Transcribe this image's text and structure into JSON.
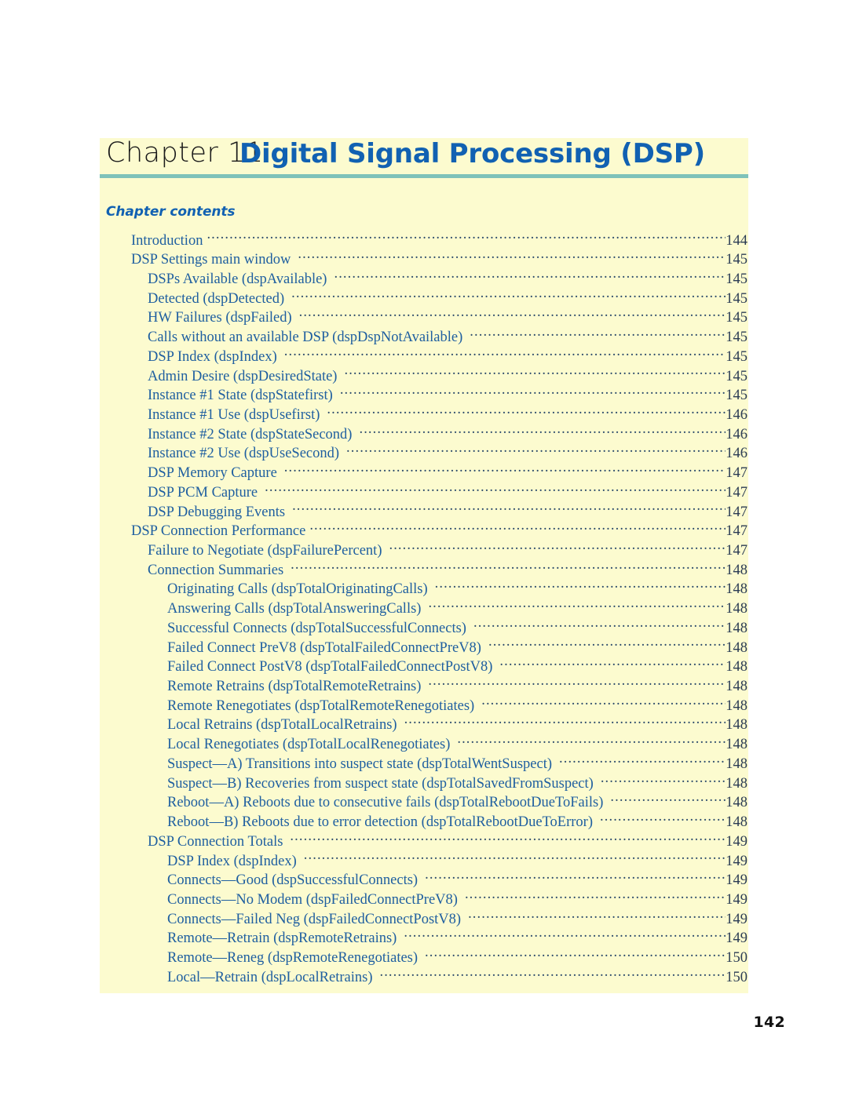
{
  "page": {
    "folio": "142",
    "accent_blue": "#1161b2",
    "toc_blue": "#1f5fa0",
    "panel_background": "#fcfbcf",
    "rule_color": "#7fc2b9"
  },
  "header": {
    "chapter_word": "Chapter 11",
    "chapter_title": "Digital Signal Processing (DSP)"
  },
  "contents": {
    "label": "Chapter contents",
    "entries": [
      {
        "level": 1,
        "label": "Introduction",
        "page": "144",
        "gap": "tight"
      },
      {
        "level": 1,
        "label": "DSP Settings main window",
        "page": "145",
        "gap": "wide"
      },
      {
        "level": 2,
        "label": "DSPs Available (dspAvailable)",
        "page": "145",
        "gap": "wide"
      },
      {
        "level": 2,
        "label": "Detected (dspDetected)",
        "page": "145",
        "gap": "wide"
      },
      {
        "level": 2,
        "label": "HW Failures (dspFailed)",
        "page": "145",
        "gap": "wide"
      },
      {
        "level": 2,
        "label": "Calls without an available DSP (dspDspNotAvailable)",
        "page": "145",
        "gap": "wide"
      },
      {
        "level": 2,
        "label": "DSP Index (dspIndex)",
        "page": "145",
        "gap": "wide"
      },
      {
        "level": 2,
        "label": "Admin Desire (dspDesiredState)",
        "page": "145",
        "gap": "wide"
      },
      {
        "level": 2,
        "label": "Instance #1 State (dspStatefirst)",
        "page": "145",
        "gap": "wide"
      },
      {
        "level": 2,
        "label": "Instance #1 Use (dspUsefirst)",
        "page": "146",
        "gap": "wide"
      },
      {
        "level": 2,
        "label": "Instance #2 State (dspStateSecond)",
        "page": "146",
        "gap": "wide"
      },
      {
        "level": 2,
        "label": "Instance #2 Use (dspUseSecond)",
        "page": "146",
        "gap": "wide"
      },
      {
        "level": 2,
        "label": "DSP Memory Capture",
        "page": "147",
        "gap": "wide"
      },
      {
        "level": 2,
        "label": "DSP PCM Capture",
        "page": "147",
        "gap": "wide"
      },
      {
        "level": 2,
        "label": "DSP Debugging Events",
        "page": "147",
        "gap": "wide"
      },
      {
        "level": 1,
        "label": "DSP Connection Performance",
        "page": "147",
        "gap": "tight"
      },
      {
        "level": 2,
        "label": "Failure to Negotiate (dspFailurePercent)",
        "page": "147",
        "gap": "wide"
      },
      {
        "level": 2,
        "label": "Connection Summaries",
        "page": "148",
        "gap": "wide"
      },
      {
        "level": 3,
        "label": "Originating Calls (dspTotalOriginatingCalls)",
        "page": "148",
        "gap": "wide"
      },
      {
        "level": 3,
        "label": "Answering Calls (dspTotalAnsweringCalls)",
        "page": "148",
        "gap": "wide"
      },
      {
        "level": 3,
        "label": "Successful Connects (dspTotalSuccessfulConnects)",
        "page": "148",
        "gap": "wide"
      },
      {
        "level": 3,
        "label": "Failed Connect PreV8 (dspTotalFailedConnectPreV8)",
        "page": "148",
        "gap": "wide"
      },
      {
        "level": 3,
        "label": "Failed Connect PostV8 (dspTotalFailedConnectPostV8)",
        "page": "148",
        "gap": "wide"
      },
      {
        "level": 3,
        "label": "Remote Retrains (dspTotalRemoteRetrains)",
        "page": "148",
        "gap": "wide"
      },
      {
        "level": 3,
        "label": "Remote Renegotiates (dspTotalRemoteRenegotiates)",
        "page": "148",
        "gap": "wide"
      },
      {
        "level": 3,
        "label": "Local Retrains (dspTotalLocalRetrains)",
        "page": "148",
        "gap": "wide"
      },
      {
        "level": 3,
        "label": "Local Renegotiates (dspTotalLocalRenegotiates)",
        "page": "148",
        "gap": "wide"
      },
      {
        "level": 3,
        "label": "Suspect—A) Transitions into suspect state (dspTotalWentSuspect)",
        "page": "148",
        "gap": "wide"
      },
      {
        "level": 3,
        "label": "Suspect—B) Recoveries from suspect state (dspTotalSavedFromSuspect)",
        "page": "148",
        "gap": "wide"
      },
      {
        "level": 3,
        "label": "Reboot—A) Reboots due to consecutive fails (dspTotalRebootDueToFails)",
        "page": "148",
        "gap": "wide"
      },
      {
        "level": 3,
        "label": "Reboot—B) Reboots due to error detection (dspTotalRebootDueToError)",
        "page": "148",
        "gap": "wide"
      },
      {
        "level": 2,
        "label": "DSP Connection Totals",
        "page": "149",
        "gap": "wide"
      },
      {
        "level": 3,
        "label": "DSP Index (dspIndex)",
        "page": "149",
        "gap": "wide"
      },
      {
        "level": 3,
        "label": "Connects—Good (dspSuccessfulConnects)",
        "page": "149",
        "gap": "wide"
      },
      {
        "level": 3,
        "label": "Connects—No Modem (dspFailedConnectPreV8)",
        "page": "149",
        "gap": "wide"
      },
      {
        "level": 3,
        "label": "Connects—Failed Neg (dspFailedConnectPostV8)",
        "page": "149",
        "gap": "wide"
      },
      {
        "level": 3,
        "label": "Remote—Retrain (dspRemoteRetrains)",
        "page": "149",
        "gap": "wide"
      },
      {
        "level": 3,
        "label": "Remote—Reneg (dspRemoteRenegotiates)",
        "page": "150",
        "gap": "wide"
      },
      {
        "level": 3,
        "label": "Local—Retrain (dspLocalRetrains)",
        "page": "150",
        "gap": "wide"
      }
    ]
  }
}
